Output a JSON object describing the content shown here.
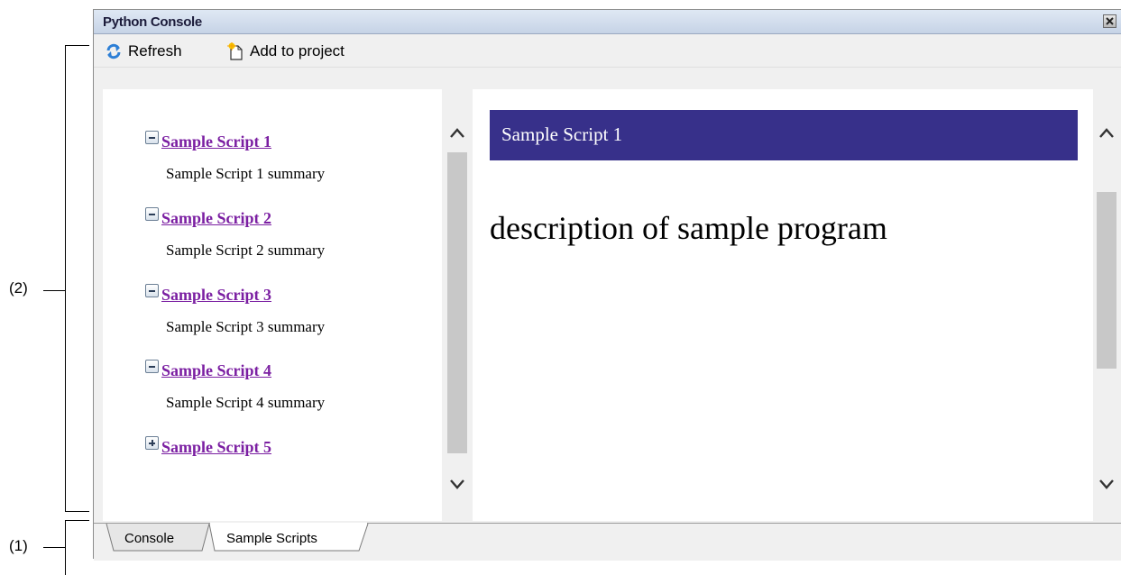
{
  "annotations": {
    "callout_2": "(2)",
    "callout_1": "(1)"
  },
  "window": {
    "title": "Python Console"
  },
  "toolbar": {
    "refresh_label": "Refresh",
    "add_to_project_label": "Add to project"
  },
  "scripts": [
    {
      "title": "Sample Script 1",
      "summary": "Sample Script 1 summary",
      "expanded": true
    },
    {
      "title": "Sample Script 2",
      "summary": "Sample Script 2 summary",
      "expanded": true
    },
    {
      "title": "Sample Script 3",
      "summary": "Sample Script 3 summary",
      "expanded": true
    },
    {
      "title": "Sample Script 4",
      "summary": "Sample Script 4 summary",
      "expanded": true
    },
    {
      "title": "Sample Script 5",
      "summary": "",
      "expanded": false
    }
  ],
  "detail": {
    "header": "Sample Script 1",
    "description": "description of sample program"
  },
  "tabs": {
    "console": "Console",
    "sample_scripts": "Sample Scripts",
    "active": "Sample Scripts"
  },
  "colors": {
    "header_bg": "#37308a",
    "link": "#7b1fa2",
    "titlebar": "#c6d3e6"
  }
}
